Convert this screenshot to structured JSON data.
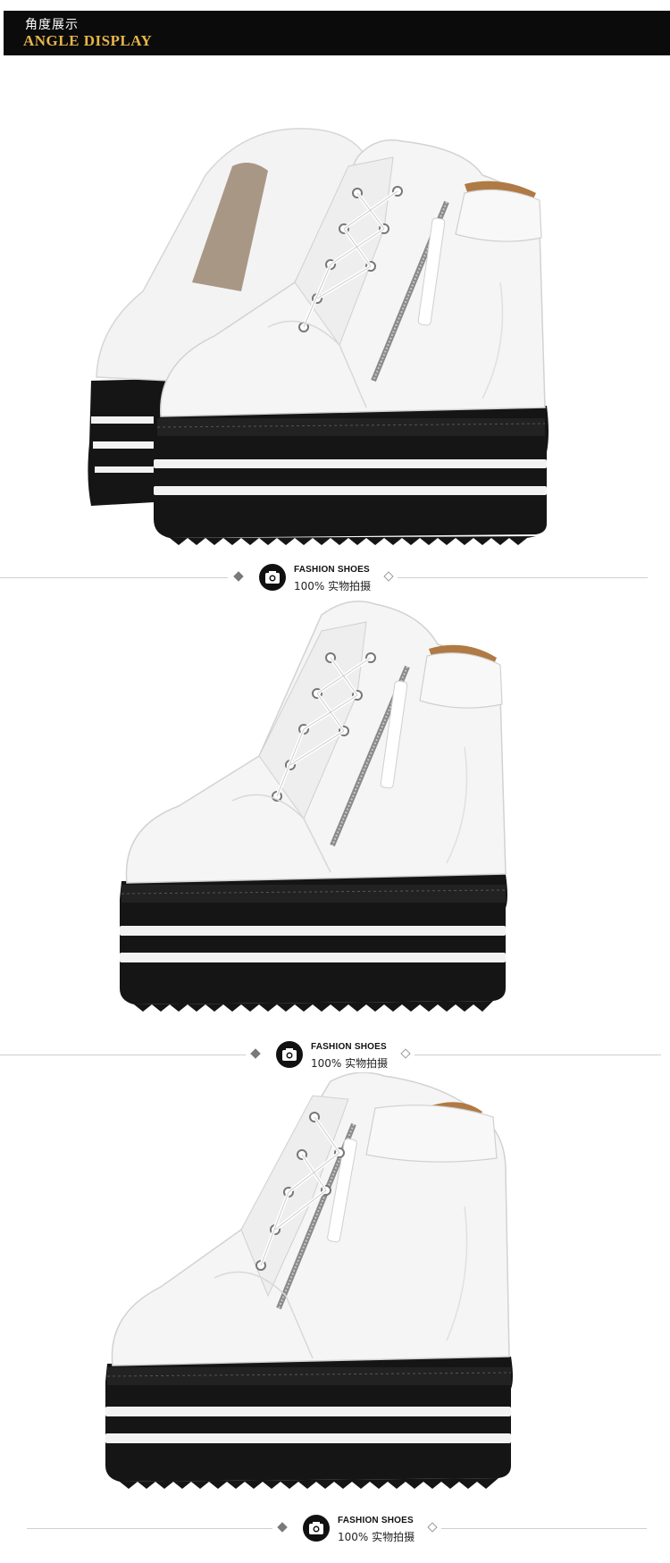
{
  "header": {
    "title_cn": "角度展示",
    "title_en": "ANGLE DISPLAY"
  },
  "separator": {
    "label_en": "FASHION SHOES",
    "label_cn": "100% 实物拍摄"
  },
  "icons": {
    "camera": "camera-icon",
    "diamond": "diamond-icon"
  },
  "colors": {
    "banner_bg": "#0b0b0b",
    "banner_accent": "#e7b54a",
    "shoe_white": "#f4f4f4",
    "sole_black": "#151515"
  }
}
